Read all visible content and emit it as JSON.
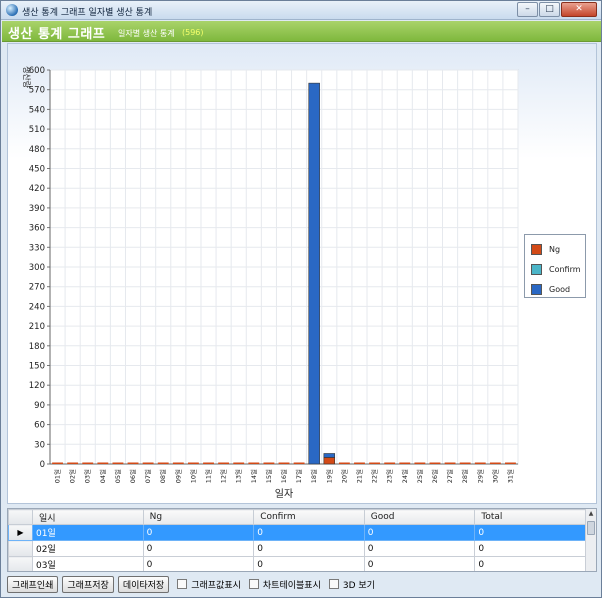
{
  "window": {
    "title": "생산 통계 그래프 일자별 생산 통계",
    "buttons": {
      "minimize": "–",
      "maximize": "□",
      "close": "✕"
    }
  },
  "header": {
    "title": "생산 통계 그래프",
    "subtitle": "일자별 생산 통계",
    "count": "(596)",
    "accent_color": "#8dc34f",
    "count_color": "#f4ff6a"
  },
  "chart_data": {
    "type": "bar",
    "stacked": true,
    "xlabel": "일자",
    "ylabel": "생산량",
    "ylim": [
      0,
      600
    ],
    "ytick_step": 30,
    "grid": true,
    "legend_position": "right",
    "categories": [
      "01일",
      "02일",
      "03일",
      "04일",
      "05일",
      "06일",
      "07일",
      "08일",
      "09일",
      "10일",
      "11일",
      "12일",
      "13일",
      "14일",
      "15일",
      "16일",
      "17일",
      "18일",
      "19일",
      "20일",
      "21일",
      "22일",
      "23일",
      "24일",
      "25일",
      "26일",
      "27일",
      "28일",
      "29일",
      "30일",
      "31일"
    ],
    "series": [
      {
        "name": "Ng",
        "color": "#d34a17",
        "values": [
          0,
          0,
          0,
          0,
          0,
          0,
          0,
          0,
          0,
          0,
          0,
          0,
          0,
          0,
          0,
          0,
          0,
          0,
          10,
          0,
          0,
          0,
          0,
          0,
          0,
          0,
          0,
          0,
          0,
          0,
          0
        ]
      },
      {
        "name": "Confirm",
        "color": "#4bb5c8",
        "values": [
          0,
          0,
          0,
          0,
          0,
          0,
          0,
          0,
          0,
          0,
          0,
          0,
          0,
          0,
          0,
          0,
          0,
          0,
          0,
          0,
          0,
          0,
          0,
          0,
          0,
          0,
          0,
          0,
          0,
          0,
          0
        ]
      },
      {
        "name": "Good",
        "color": "#2a68c4",
        "values": [
          0,
          0,
          0,
          0,
          0,
          0,
          0,
          0,
          0,
          0,
          0,
          0,
          0,
          0,
          0,
          0,
          0,
          580,
          6,
          0,
          0,
          0,
          0,
          0,
          0,
          0,
          0,
          0,
          0,
          0,
          0
        ]
      }
    ]
  },
  "grid": {
    "columns": [
      "일시",
      "Ng",
      "Confirm",
      "Good",
      "Total"
    ],
    "rows": [
      [
        "01일",
        "0",
        "0",
        "0",
        "0"
      ],
      [
        "02일",
        "0",
        "0",
        "0",
        "0"
      ],
      [
        "03일",
        "0",
        "0",
        "0",
        "0"
      ]
    ],
    "selected_row_marker": "▶"
  },
  "toolbar": {
    "print_graph": "그래프인쇄",
    "save_graph": "그래프저장",
    "save_data": "데이타저장",
    "show_values": "그래프값표시",
    "show_chart_table": "차트테이블표시",
    "view_3d": "3D 보기"
  }
}
